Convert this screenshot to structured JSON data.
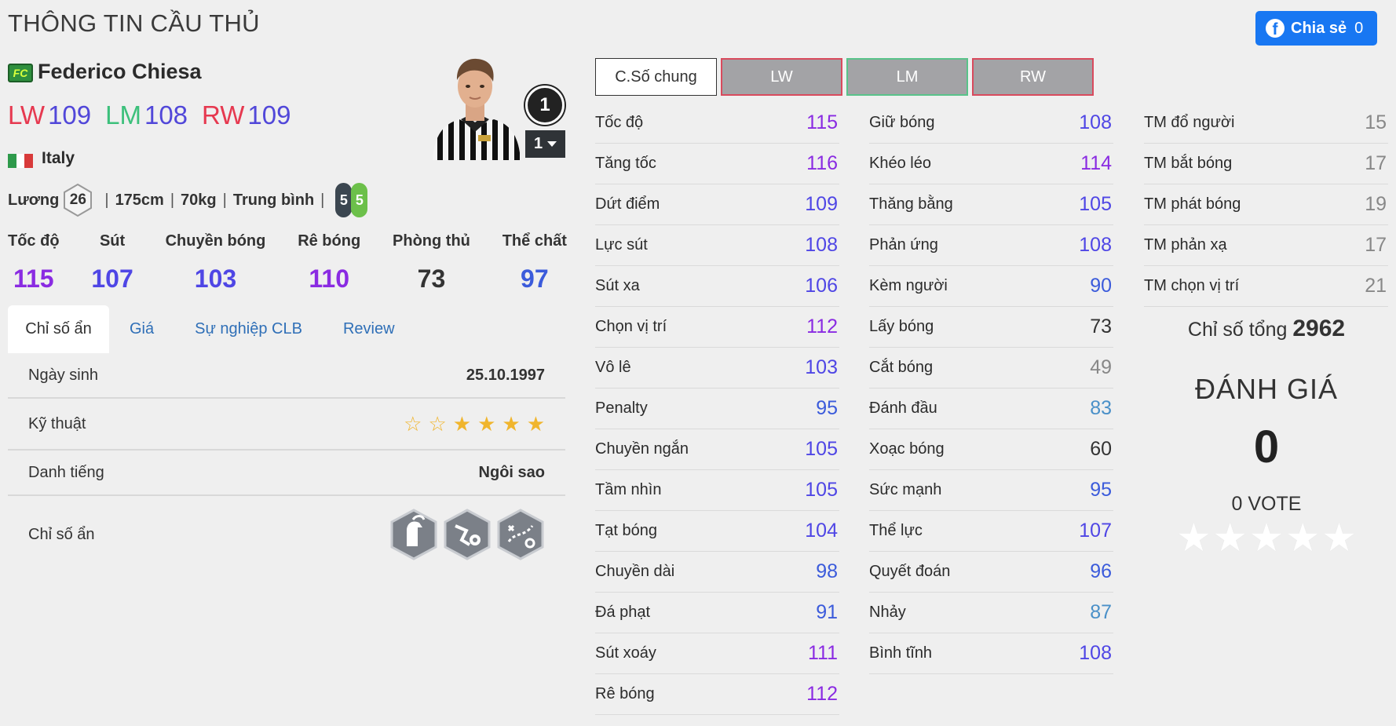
{
  "header": {
    "title": "THÔNG TIN CẦU THỦ",
    "share_label": "Chia sẻ",
    "share_count": "0",
    "fb_glyph": "f"
  },
  "player": {
    "badge": "FC",
    "name": "Federico Chiesa",
    "positions": [
      {
        "pos": "LW",
        "rating": "109"
      },
      {
        "pos": "LM",
        "rating": "108"
      },
      {
        "pos": "RW",
        "rating": "109"
      }
    ],
    "nation": "Italy",
    "flag_colors": [
      "#2e9a4b",
      "#ffffff",
      "#d83a3a"
    ],
    "wage_label": "Lương",
    "wage": "26",
    "height": "175cm",
    "weight": "70kg",
    "build": "Trung bình",
    "weak_foot": "5",
    "strong_foot": "5",
    "level": "1",
    "level_select": "1"
  },
  "main_stats": [
    {
      "label": "Tốc độ",
      "value": "115",
      "color": "#8a2be2"
    },
    {
      "label": "Sút",
      "value": "107",
      "color": "#4f46e5"
    },
    {
      "label": "Chuyền bóng",
      "value": "103",
      "color": "#4f46e5"
    },
    {
      "label": "Rê bóng",
      "value": "110",
      "color": "#8a2be2"
    },
    {
      "label": "Phòng thủ",
      "value": "73",
      "color": "#333333"
    },
    {
      "label": "Thể chất",
      "value": "97",
      "color": "#3b5bdb"
    }
  ],
  "tabs": [
    "Chỉ số ẩn",
    "Giá",
    "Sự nghiệp CLB",
    "Review"
  ],
  "panel": {
    "birth_label": "Ngày sinh",
    "birth_value": "25.10.1997",
    "skill_label": "Kỹ thuật",
    "skill_stars": 4,
    "fame_label": "Danh tiếng",
    "fame_value": "Ngôi sao",
    "hidden_label": "Chỉ số ẩn"
  },
  "pos_tabs": [
    "C.Số chung",
    "LW",
    "LM",
    "RW"
  ],
  "stats_col1": [
    {
      "name": "Tốc độ",
      "value": "115",
      "color": "#8a2be2"
    },
    {
      "name": "Tăng tốc",
      "value": "116",
      "color": "#8a2be2"
    },
    {
      "name": "Dứt điểm",
      "value": "109",
      "color": "#4f46e5"
    },
    {
      "name": "Lực sút",
      "value": "108",
      "color": "#4f46e5"
    },
    {
      "name": "Sút xa",
      "value": "106",
      "color": "#4f46e5"
    },
    {
      "name": "Chọn vị trí",
      "value": "112",
      "color": "#8a2be2"
    },
    {
      "name": "Vô lê",
      "value": "103",
      "color": "#4f46e5"
    },
    {
      "name": "Penalty",
      "value": "95",
      "color": "#3b5bdb"
    },
    {
      "name": "Chuyền ngắn",
      "value": "105",
      "color": "#4f46e5"
    },
    {
      "name": "Tầm nhìn",
      "value": "105",
      "color": "#4f46e5"
    },
    {
      "name": "Tạt bóng",
      "value": "104",
      "color": "#4f46e5"
    },
    {
      "name": "Chuyền dài",
      "value": "98",
      "color": "#3b5bdb"
    },
    {
      "name": "Đá phạt",
      "value": "91",
      "color": "#3b5bdb"
    },
    {
      "name": "Sút xoáy",
      "value": "111",
      "color": "#8a2be2"
    },
    {
      "name": "Rê bóng",
      "value": "112",
      "color": "#8a2be2"
    }
  ],
  "stats_col2": [
    {
      "name": "Giữ bóng",
      "value": "108",
      "color": "#4f46e5"
    },
    {
      "name": "Khéo léo",
      "value": "114",
      "color": "#8a2be2"
    },
    {
      "name": "Thăng bằng",
      "value": "105",
      "color": "#4f46e5"
    },
    {
      "name": "Phản ứng",
      "value": "108",
      "color": "#4f46e5"
    },
    {
      "name": "Kèm người",
      "value": "90",
      "color": "#3b5bdb"
    },
    {
      "name": "Lấy bóng",
      "value": "73",
      "color": "#333333"
    },
    {
      "name": "Cắt bóng",
      "value": "49",
      "color": "#888888"
    },
    {
      "name": "Đánh đầu",
      "value": "83",
      "color": "#4a90c8"
    },
    {
      "name": "Xoạc bóng",
      "value": "60",
      "color": "#333333"
    },
    {
      "name": "Sức mạnh",
      "value": "95",
      "color": "#3b5bdb"
    },
    {
      "name": "Thể lực",
      "value": "107",
      "color": "#4f46e5"
    },
    {
      "name": "Quyết đoán",
      "value": "96",
      "color": "#3b5bdb"
    },
    {
      "name": "Nhảy",
      "value": "87",
      "color": "#4a90c8"
    },
    {
      "name": "Bình tĩnh",
      "value": "108",
      "color": "#4f46e5"
    }
  ],
  "stats_col3": [
    {
      "name": "TM đổ người",
      "value": "15",
      "color": "#888888"
    },
    {
      "name": "TM bắt bóng",
      "value": "17",
      "color": "#888888"
    },
    {
      "name": "TM phát bóng",
      "value": "19",
      "color": "#888888"
    },
    {
      "name": "TM phản xạ",
      "value": "17",
      "color": "#888888"
    },
    {
      "name": "TM chọn vị trí",
      "value": "21",
      "color": "#888888"
    }
  ],
  "summary": {
    "total_label": "Chỉ số tổng",
    "total_value": "2962",
    "rating_title": "ĐÁNH GIÁ",
    "rating_value": "0",
    "votes": "0 VOTE"
  }
}
